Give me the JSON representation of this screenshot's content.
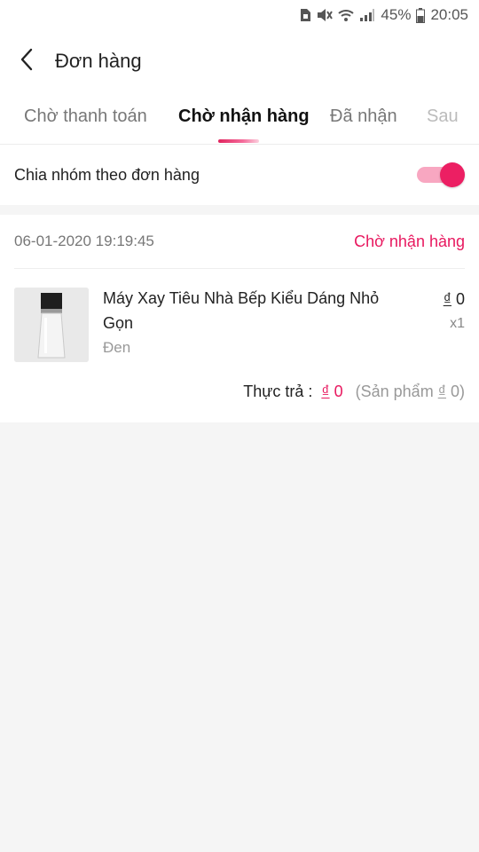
{
  "status_bar": {
    "battery": "45%",
    "time": "20:05",
    "icons": [
      "sim-icon",
      "mute-icon",
      "wifi-icon",
      "signal-icon",
      "battery-icon"
    ]
  },
  "header": {
    "title": "Đơn hàng",
    "back_icon": "chevron-left-icon"
  },
  "tabs": [
    {
      "label": "Chờ thanh toán",
      "active": false
    },
    {
      "label": "Chờ nhận hàng",
      "active": true
    },
    {
      "label": "Đã nhận",
      "active": false
    },
    {
      "label": "Sau",
      "active": false
    }
  ],
  "group_by_order": {
    "label": "Chia nhóm theo đơn hàng",
    "enabled": true
  },
  "order": {
    "date": "06-01-2020 19:19:45",
    "status": "Chờ nhận hàng",
    "product": {
      "name": "Máy Xay Tiêu Nhà Bếp Kiểu Dáng Nhỏ Gọn",
      "variant": "Đen",
      "currency": "₫",
      "price": "0",
      "quantity": "x1"
    },
    "total": {
      "label": "Thực trả :",
      "currency": "₫",
      "amount": "0",
      "note_prefix": "(Sản phẩm",
      "note_currency": "₫",
      "note_amount": "0",
      "note_suffix": ")"
    }
  },
  "colors": {
    "accent": "#e8185f",
    "toggle_track": "#f8a7c1",
    "background": "#f5f5f5"
  }
}
